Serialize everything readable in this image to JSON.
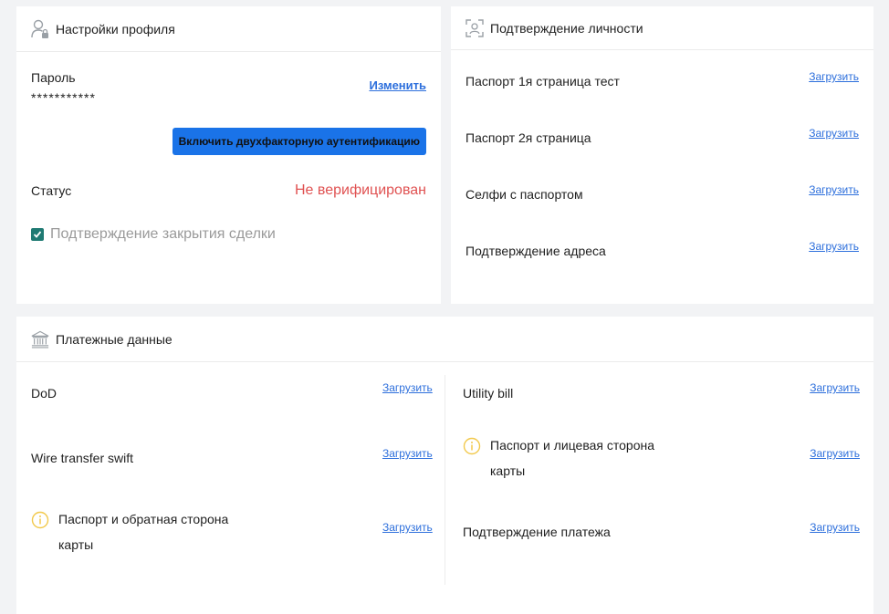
{
  "profile": {
    "title": "Настройки профиля",
    "icon": "user-lock-icon",
    "password_label": "Пароль",
    "password_value": "***********",
    "change_link": "Изменить",
    "twofa_button": "Включить двухфакторную аутентификацию",
    "status_label": "Статус",
    "status_value": "Не верифицирован",
    "status_color": "#e05252",
    "deal_confirm_label": "Подтверждение закрытия сделки",
    "deal_confirm_checked": true
  },
  "identity": {
    "title": "Подтверждение личности",
    "icon": "face-scan-icon",
    "items": [
      {
        "label": "Паспорт 1я страница тест",
        "action": "Загрузить"
      },
      {
        "label": "Паспорт 2я страница",
        "action": "Загрузить"
      },
      {
        "label": "Селфи с паспортом",
        "action": "Загрузить"
      },
      {
        "label": "Подтверждение адреса",
        "action": "Загрузить"
      }
    ]
  },
  "payment": {
    "title": "Платежные данные",
    "icon": "bank-icon",
    "left": [
      {
        "label": "DoD",
        "action": "Загрузить"
      },
      {
        "label": "Wire transfer swift",
        "action": "Загрузить"
      },
      {
        "label_line1": "Паспорт и обратная сторона",
        "label_line2": "карты",
        "action": "Загрузить",
        "info": "info-icon"
      }
    ],
    "right": [
      {
        "label": "Utility bill",
        "action": "Загрузить"
      },
      {
        "label_line1": "Паспорт и лицевая сторона",
        "label_line2": "карты",
        "action": "Загрузить",
        "info": "info-icon"
      },
      {
        "label": "Подтверждение платежа",
        "action": "Загрузить"
      }
    ]
  },
  "colors": {
    "accent": "#1a73e8",
    "link": "#2d6fdc",
    "checkbox": "#1f7a73",
    "info": "#f2c94c"
  }
}
